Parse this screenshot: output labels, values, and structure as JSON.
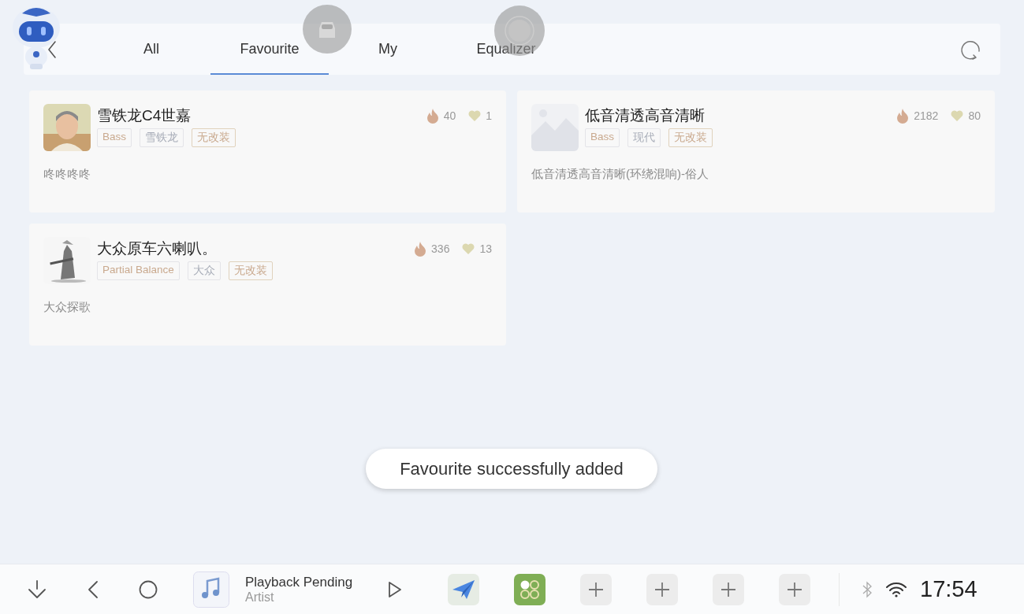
{
  "tabs": [
    {
      "label": "All",
      "selected": false
    },
    {
      "label": "Favourite",
      "selected": true
    },
    {
      "label": "My",
      "selected": false
    },
    {
      "label": "Equalizer",
      "selected": false
    }
  ],
  "cards": [
    {
      "title": "雪铁龙C4世嘉",
      "hot": "40",
      "likes": "1",
      "description": "咚咚咚咚",
      "tags": [
        {
          "label": "Bass",
          "kind": "style"
        },
        {
          "label": "雪铁龙",
          "kind": "brand"
        },
        {
          "label": "无改装",
          "kind": "mod"
        }
      ]
    },
    {
      "title": "低音清透高音清晰",
      "hot": "2182",
      "likes": "80",
      "description": "低音清透高音清晰(环绕混响)-俗人",
      "tags": [
        {
          "label": "Bass",
          "kind": "style"
        },
        {
          "label": "现代",
          "kind": "brand"
        },
        {
          "label": "无改装",
          "kind": "mod"
        }
      ]
    },
    {
      "title": "大众原车六喇叭。",
      "hot": "336",
      "likes": "13",
      "description": "大众探歌",
      "tags": [
        {
          "label": "Partial Balance",
          "kind": "style"
        },
        {
          "label": "大众",
          "kind": "brand"
        },
        {
          "label": "无改装",
          "kind": "mod"
        }
      ]
    }
  ],
  "toast": "Favourite successfully added",
  "player": {
    "title": "Playback Pending",
    "artist": "Artist"
  },
  "dock": [
    {
      "kind": "plane"
    },
    {
      "kind": "apps"
    },
    {
      "kind": "add"
    },
    {
      "kind": "add"
    },
    {
      "kind": "add"
    },
    {
      "kind": "add"
    }
  ],
  "status": {
    "time": "17:54"
  }
}
